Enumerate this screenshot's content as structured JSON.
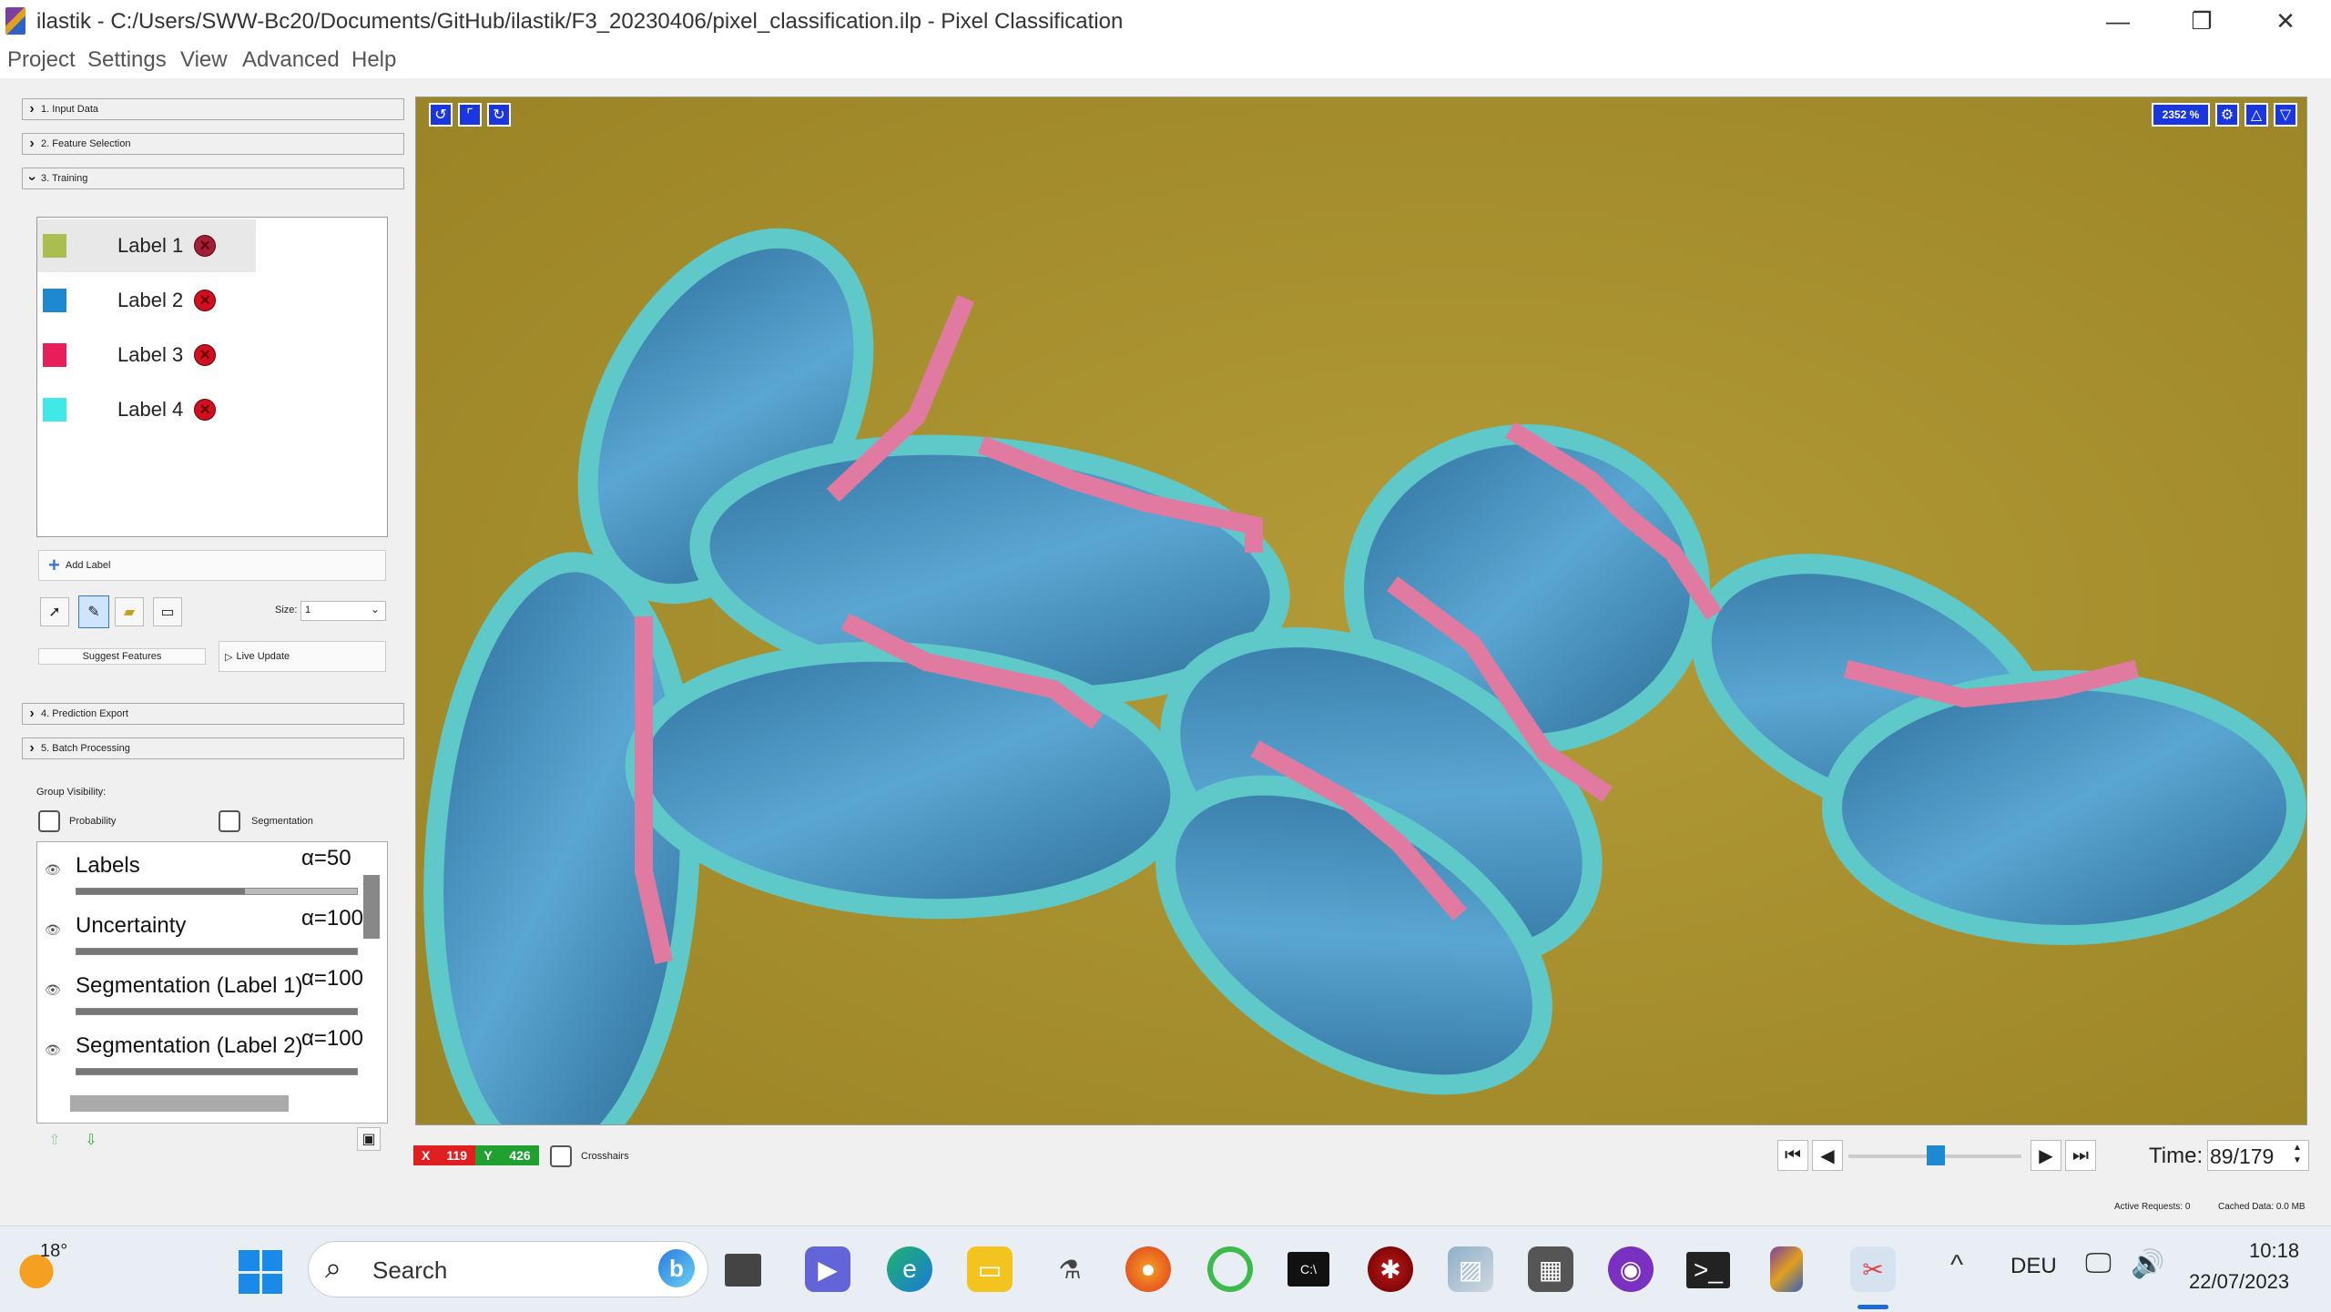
{
  "window": {
    "title": "ilastik - C:/Users/SWW-Bc20/Documents/GitHub/ilastik/F3_20230406/pixel_classification.ilp - Pixel Classification",
    "minimize": "—",
    "maximize": "❐",
    "close": "✕"
  },
  "menu": [
    "Project",
    "Settings",
    "View",
    "Advanced",
    "Help"
  ],
  "applets": {
    "input_data": "1. Input Data",
    "feature_selection": "2. Feature Selection",
    "training": "3. Training",
    "prediction_export": "4. Prediction Export",
    "batch_processing": "5. Batch Processing"
  },
  "labels": [
    {
      "name": "Label 1",
      "color": "#a9be4e"
    },
    {
      "name": "Label 2",
      "color": "#1e88d0"
    },
    {
      "name": "Label 3",
      "color": "#e81e5a"
    },
    {
      "name": "Label 4",
      "color": "#40e8e8"
    }
  ],
  "training": {
    "add_label": "Add Label",
    "size_label": "Size:",
    "size_value": "1",
    "suggest_features": "Suggest Features",
    "live_update": "Live Update"
  },
  "group_visibility": {
    "title": "Group Visibility:",
    "probability": "Probability",
    "segmentation": "Segmentation"
  },
  "layers": [
    {
      "name": "Labels",
      "alpha": "α=50",
      "opacity": 0.5
    },
    {
      "name": "Uncertainty",
      "alpha": "α=100",
      "opacity": 1.0
    },
    {
      "name": "Segmentation (Label 1)",
      "alpha": "α=100",
      "opacity": 1.0
    },
    {
      "name": "Segmentation (Label 2)",
      "alpha": "α=100",
      "opacity": 1.0
    }
  ],
  "viewer": {
    "zoom": "2352 %"
  },
  "coords": {
    "x_label": "X",
    "x": "119",
    "y_label": "Y",
    "y": "426"
  },
  "crosshairs": "Crosshairs",
  "time": {
    "label": "Time:",
    "value": "89/179",
    "position": 0.5
  },
  "status": {
    "active_requests": "Active Requests: 0",
    "cached_data": "Cached Data: 0.0 MB"
  },
  "taskbar": {
    "weather": "18°",
    "search_placeholder": "Search",
    "language": "DEU",
    "clock_time": "10:18",
    "clock_date": "22/07/2023"
  },
  "colors": {
    "background_field": "#a7902c",
    "cell_body": "#3e88b8",
    "cell_border": "#5fc8c8",
    "label_stroke": "#e07aa0"
  }
}
